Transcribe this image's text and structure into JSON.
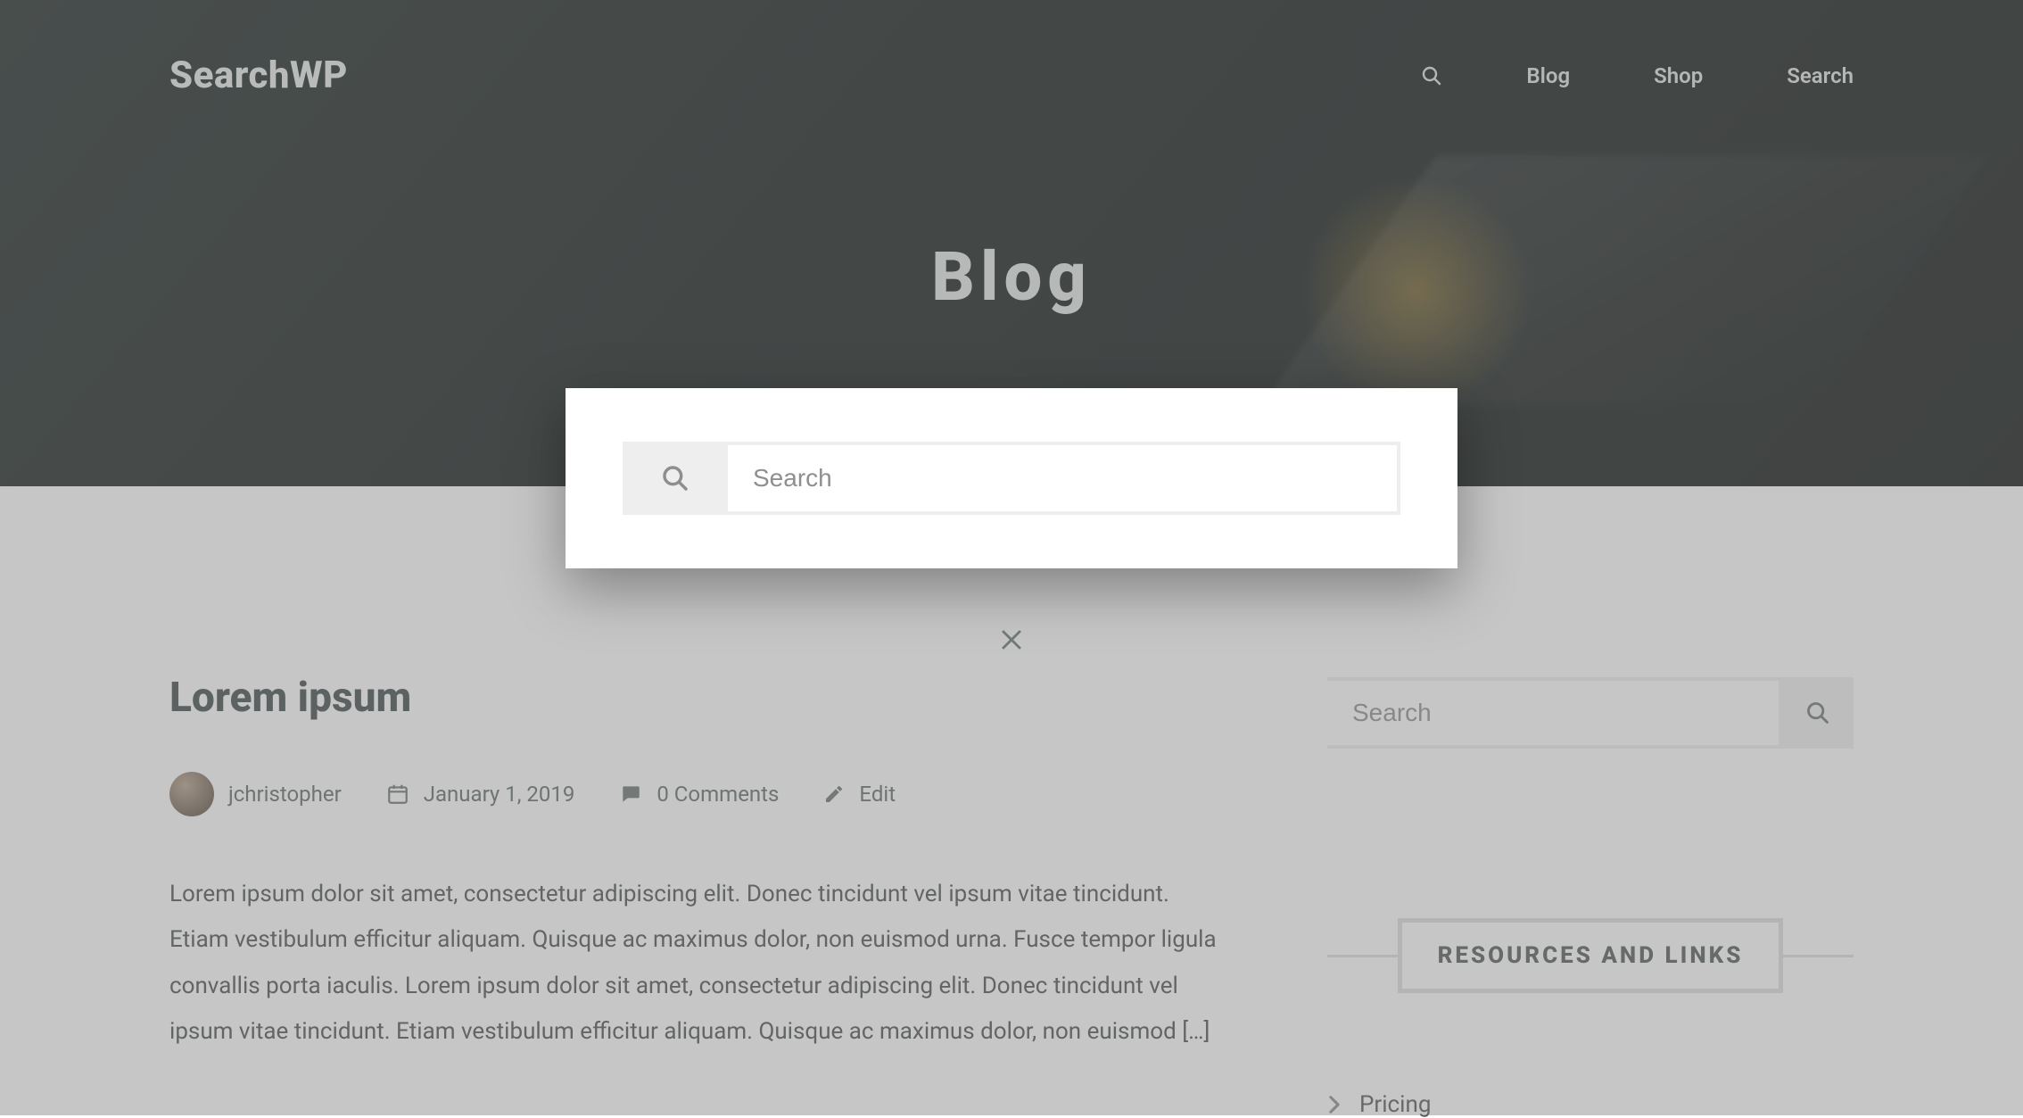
{
  "brand": "SearchWP",
  "nav": {
    "blog": "Blog",
    "shop": "Shop",
    "search": "Search"
  },
  "hero": {
    "title": "Blog"
  },
  "modal": {
    "search_placeholder": "Search"
  },
  "post": {
    "title": "Lorem ipsum",
    "author": "jchristopher",
    "date": "January 1, 2019",
    "comments": "0 Comments",
    "edit": "Edit",
    "excerpt": "Lorem ipsum dolor sit amet, consectetur adipiscing elit. Donec tincidunt vel ipsum vitae tincidunt. Etiam vestibulum efficitur aliquam. Quisque ac maximus dolor, non euismod urna. Fusce tempor ligula convallis porta iaculis. Lorem ipsum dolor sit amet, consectetur adipiscing elit. Donec tincidunt vel ipsum vitae tincidunt. Etiam vestibulum efficitur aliquam. Quisque ac maximus dolor, non euismod […]"
  },
  "sidebar": {
    "search_placeholder": "Search",
    "resources_title": "RESOURCES AND LINKS",
    "links": {
      "pricing": "Pricing"
    }
  }
}
